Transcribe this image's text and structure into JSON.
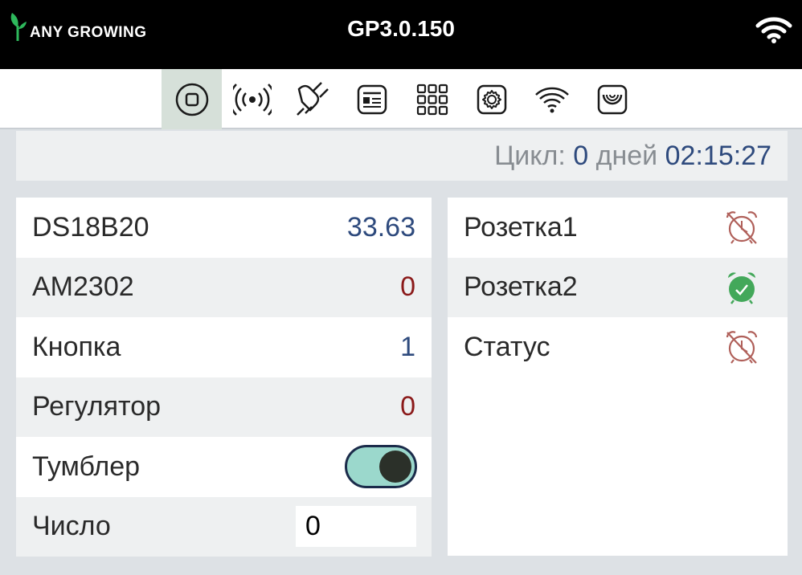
{
  "header": {
    "logo_text": "ANY GROWING",
    "version": "GP3.0.150",
    "wifi_icon": "wifi-icon"
  },
  "nav": {
    "items": [
      {
        "name": "home",
        "icon": "home-icon",
        "active": true
      },
      {
        "name": "sensors",
        "icon": "broadcast-icon",
        "active": false
      },
      {
        "name": "power",
        "icon": "plug-icon",
        "active": false
      },
      {
        "name": "display",
        "icon": "panel-icon",
        "active": false
      },
      {
        "name": "grid",
        "icon": "grid-icon",
        "active": false
      },
      {
        "name": "settings",
        "icon": "gear-icon",
        "active": false
      },
      {
        "name": "wifi",
        "icon": "wifi-icon",
        "active": false
      },
      {
        "name": "camera",
        "icon": "lens-icon",
        "active": false
      }
    ]
  },
  "cycle": {
    "label": "Цикл:",
    "days_value": "0",
    "days_label": "дней",
    "time": "02:15:27"
  },
  "sensors": [
    {
      "name": "DS18B20",
      "value": "33.63",
      "color": "#2e4a7d"
    },
    {
      "name": "AM2302",
      "value": "0",
      "color": "#8b1a1a"
    },
    {
      "name": "Кнопка",
      "value": "1",
      "color": "#2e4a7d"
    },
    {
      "name": "Регулятор",
      "value": "0",
      "color": "#8b1a1a"
    },
    {
      "name": "Тумблер",
      "toggle_on": true
    },
    {
      "name": "Число",
      "input_value": "0"
    }
  ],
  "outlets": [
    {
      "name": "Розетка1",
      "icon": "alarm-off-icon",
      "state": "off"
    },
    {
      "name": "Розетка2",
      "icon": "alarm-check-icon",
      "state": "on"
    },
    {
      "name": "Статус",
      "icon": "alarm-off-icon",
      "state": "off"
    }
  ],
  "colors": {
    "accent_blue": "#2e4a7d",
    "accent_red": "#8b1a1a",
    "alarm_off": "#b0605a",
    "alarm_on": "#43a85a",
    "toggle_bg": "#9bd8cc"
  }
}
